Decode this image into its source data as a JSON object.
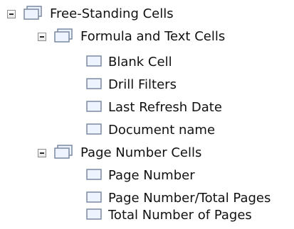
{
  "tree": {
    "root": {
      "label": "Free-Standing Cells",
      "expanded": true,
      "icon": "stacked-cell-icon"
    },
    "group1": {
      "label": "Formula and Text Cells",
      "expanded": true,
      "icon": "stacked-cell-icon",
      "items": [
        {
          "label": "Blank Cell",
          "icon": "cell-icon"
        },
        {
          "label": "Drill Filters",
          "icon": "cell-icon"
        },
        {
          "label": "Last Refresh Date",
          "icon": "cell-icon"
        },
        {
          "label": "Document name",
          "icon": "cell-icon"
        }
      ]
    },
    "group2": {
      "label": "Page Number Cells",
      "expanded": true,
      "icon": "stacked-cell-icon",
      "items": [
        {
          "label": "Page Number",
          "icon": "cell-icon"
        },
        {
          "label": "Page Number/Total Pages",
          "icon": "cell-icon"
        },
        {
          "label": "Total Number of Pages",
          "icon": "cell-icon"
        }
      ]
    }
  },
  "colors": {
    "icon_border": "#7a8aa0",
    "icon_fill": "#eef4ff",
    "toggle_border": "#8c8c8c",
    "text": "#111111"
  }
}
